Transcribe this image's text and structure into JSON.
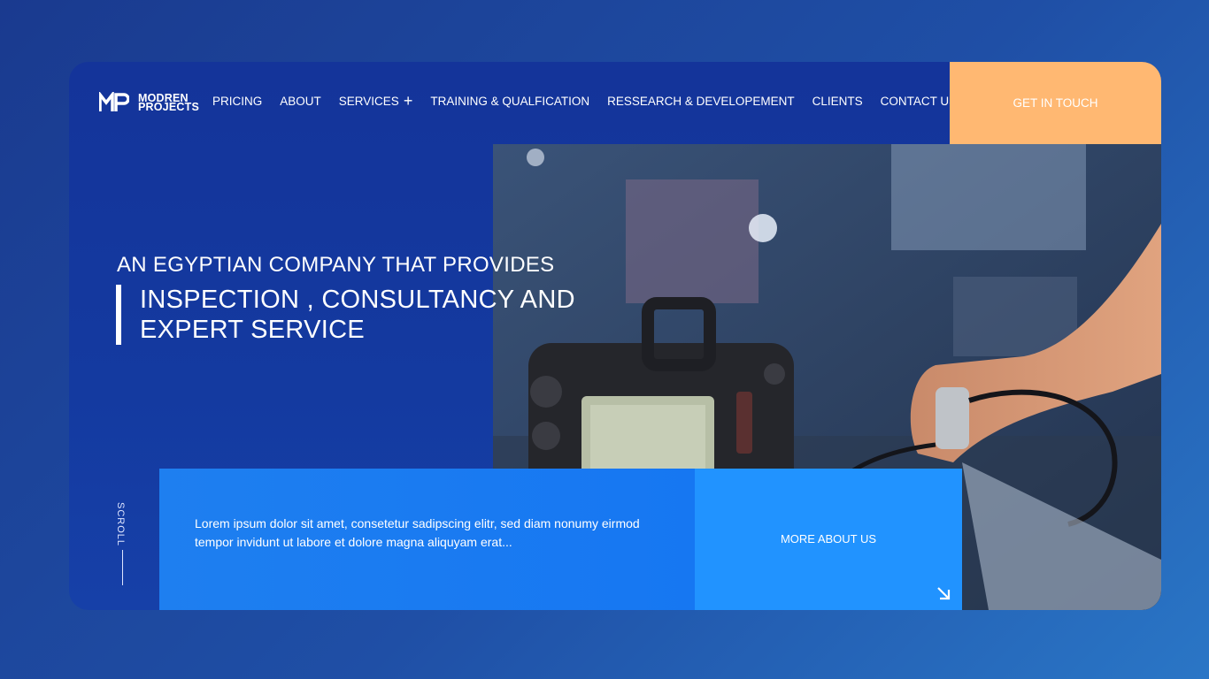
{
  "brand": {
    "line1": "MODREN",
    "line2": "PROJECTS"
  },
  "nav": {
    "items": [
      "PRICING",
      "ABOUT",
      "SERVICES",
      "TRAINING & QUALFICATION",
      "RESSEARCH & DEVELOPEMENT",
      "CLIENTS",
      "CONTACT US"
    ],
    "services_plus": "+",
    "search_icon": "search-icon"
  },
  "cta": {
    "label": "GET IN TOUCH",
    "color": "#ffb872"
  },
  "hero": {
    "subtitle": "AN EGYPTIAN COMPANY THAT PROVIDES",
    "title_line1": "INSPECTION , CONSULTANCY AND",
    "title_line2": "EXPERT SERVICE"
  },
  "scroll": {
    "label": "SCROLL"
  },
  "intro": {
    "text": "Lorem ipsum dolor sit amet, consetetur sadipscing elitr, sed diam nonumy eirmod tempor invidunt ut labore et dolore magna aliquyam erat..."
  },
  "more": {
    "label": "MORE ABOUT US",
    "icon": "arrow-down-right-icon"
  },
  "colors": {
    "accent": "#ffb872",
    "primary": "#1640a8",
    "bright_blue": "#2193ff"
  }
}
